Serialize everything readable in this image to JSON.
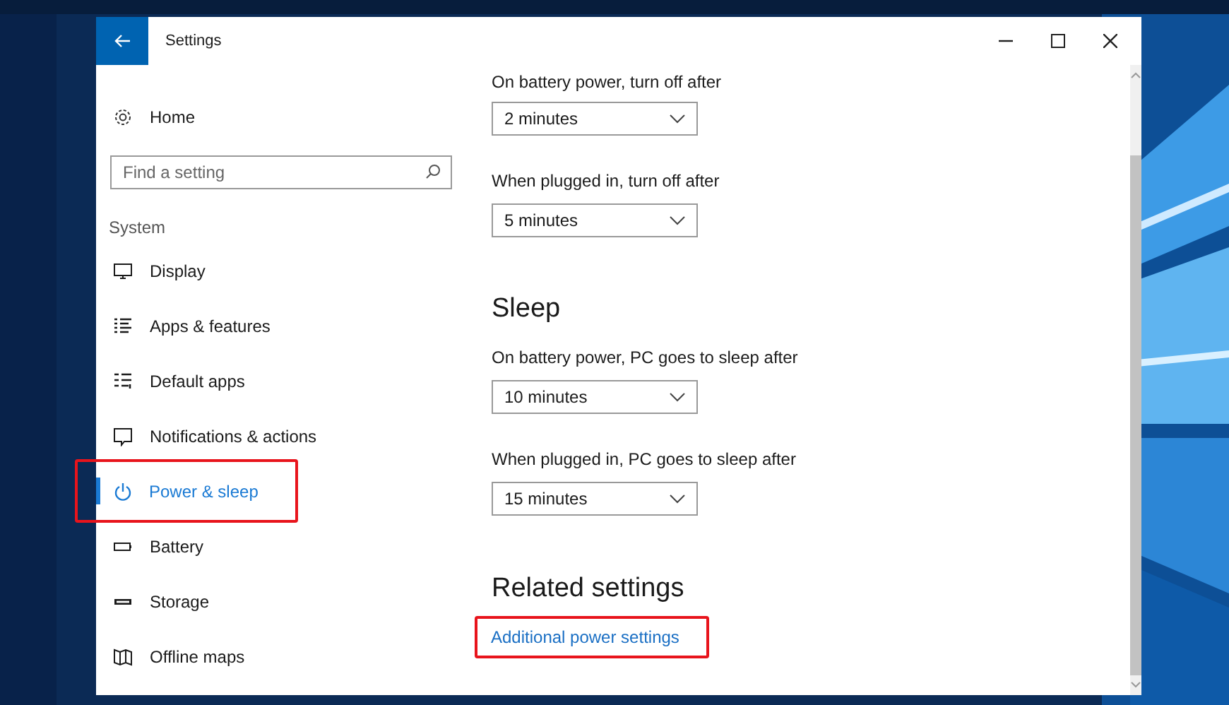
{
  "window": {
    "title": "Settings"
  },
  "sidebar": {
    "home": "Home",
    "search": {
      "placeholder": "Find a setting"
    },
    "group": "System",
    "items": [
      {
        "label": "Display",
        "kind": "display",
        "selected": false,
        "highlighted": false
      },
      {
        "label": "Apps & features",
        "kind": "apps",
        "selected": false,
        "highlighted": false
      },
      {
        "label": "Default apps",
        "kind": "defaults",
        "selected": false,
        "highlighted": false
      },
      {
        "label": "Notifications & actions",
        "kind": "notifications",
        "selected": false,
        "highlighted": false
      },
      {
        "label": "Power & sleep",
        "kind": "power",
        "selected": true,
        "highlighted": true
      },
      {
        "label": "Battery",
        "kind": "battery",
        "selected": false,
        "highlighted": false
      },
      {
        "label": "Storage",
        "kind": "storage",
        "selected": false,
        "highlighted": false
      },
      {
        "label": "Offline maps",
        "kind": "map",
        "selected": false,
        "highlighted": false
      }
    ]
  },
  "content": {
    "sections": [
      {
        "settings": [
          {
            "label": "On battery power, turn off after",
            "value": "2 minutes"
          },
          {
            "label": "When plugged in, turn off after",
            "value": "5 minutes"
          }
        ]
      },
      {
        "heading": "Sleep",
        "settings": [
          {
            "label": "On battery power, PC goes to sleep after",
            "value": "10 minutes"
          },
          {
            "label": "When plugged in, PC goes to sleep after",
            "value": "15 minutes"
          }
        ]
      }
    ],
    "related": {
      "heading": "Related settings",
      "links": [
        {
          "label": "Additional power settings",
          "highlighted": true
        }
      ]
    }
  }
}
